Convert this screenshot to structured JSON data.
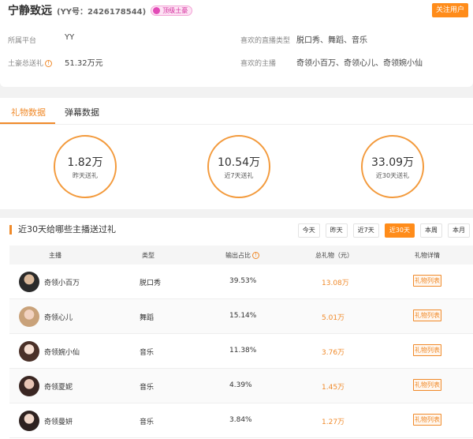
{
  "profile": {
    "name": "宁静致远",
    "yy_id": "(YY号：2426178544)",
    "badge": "顶级土豪",
    "follow_label": "关注用户",
    "platform_label": "所属平台",
    "platform_value": "YY",
    "total_gift_label": "土豪总送礼",
    "total_gift_value": "51.32万元",
    "fav_type_label": "喜欢的直播类型",
    "fav_type_value": "脱口秀、舞蹈、音乐",
    "fav_anchor_label": "喜欢的主播",
    "fav_anchor_value": "奇领小百万、奇领心儿、奇领婉小仙"
  },
  "tabs": [
    "礼物数据",
    "弹幕数据"
  ],
  "stats": [
    {
      "value": "1.82万",
      "caption": "昨天送礼"
    },
    {
      "value": "10.54万",
      "caption": "近7天送礼"
    },
    {
      "value": "33.09万",
      "caption": "近30天送礼"
    }
  ],
  "ranking": {
    "title": "近30天给哪些主播送过礼",
    "filters": [
      "今天",
      "昨天",
      "近7天",
      "近30天",
      "本周",
      "本月"
    ],
    "active_filter": "近30天",
    "headers": [
      "主播",
      "类型",
      "输出占比",
      "总礼物（元）",
      "礼物详情"
    ],
    "gift_button_label": "礼物列表",
    "rows": [
      {
        "anchor": "奇领小百万",
        "type": "脱口秀",
        "ratio": "39.53%",
        "total": "13.08万"
      },
      {
        "anchor": "奇领心儿",
        "type": "舞蹈",
        "ratio": "15.14%",
        "total": "5.01万"
      },
      {
        "anchor": "奇领婉小仙",
        "type": "音乐",
        "ratio": "11.38%",
        "total": "3.76万"
      },
      {
        "anchor": "奇领夏妮",
        "type": "音乐",
        "ratio": "4.39%",
        "total": "1.45万"
      },
      {
        "anchor": "奇领曼妍",
        "type": "音乐",
        "ratio": "3.84%",
        "total": "1.27万"
      }
    ]
  },
  "colors": {
    "accent": "#f08a2a",
    "button": "#ff8c1a"
  }
}
